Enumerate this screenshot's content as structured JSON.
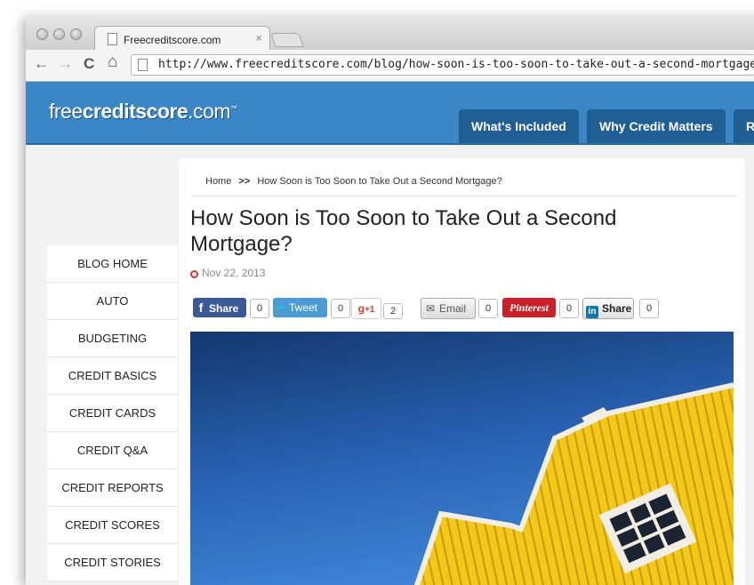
{
  "browser": {
    "tab_title": "Freecreditscore.com",
    "tab_close": "×",
    "url": "http://www.freecreditscore.com/blog/how-soon-is-too-soon-to-take-out-a-second-mortgage/",
    "nav": {
      "back": "←",
      "forward": "→",
      "reload": "C",
      "home": "⌂"
    }
  },
  "site": {
    "logo_part1": "free",
    "logo_part2": "credit",
    "logo_part3": "score",
    "logo_part4": ".com",
    "logo_tm": "™",
    "nav_tabs": [
      "What's Included",
      "Why Credit Matters",
      "R"
    ],
    "brand_color": "#3a87c8"
  },
  "sidebar": {
    "items": [
      "BLOG HOME",
      "AUTO",
      "BUDGETING",
      "CREDIT BASICS",
      "CREDIT CARDS",
      "CREDIT Q&A",
      "CREDIT REPORTS",
      "CREDIT SCORES",
      "CREDIT STORIES"
    ]
  },
  "article": {
    "breadcrumb_home": "Home",
    "breadcrumb_sep": ">>",
    "breadcrumb_current": "How Soon is Too Soon to Take Out a Second Mortgage?",
    "title": "How Soon is Too Soon to Take Out a Second Mortgage?",
    "date": "Nov 22, 2013"
  },
  "share": {
    "facebook": {
      "label": "Share",
      "count": "0"
    },
    "twitter": {
      "label": "Tweet",
      "count": "0"
    },
    "gplus": {
      "label": "+1",
      "count": "2"
    },
    "email": {
      "label": "Email",
      "count": "0"
    },
    "pinterest": {
      "label": "Pinterest",
      "count": "0"
    },
    "linkedin": {
      "label": "Share",
      "count": "0"
    }
  }
}
